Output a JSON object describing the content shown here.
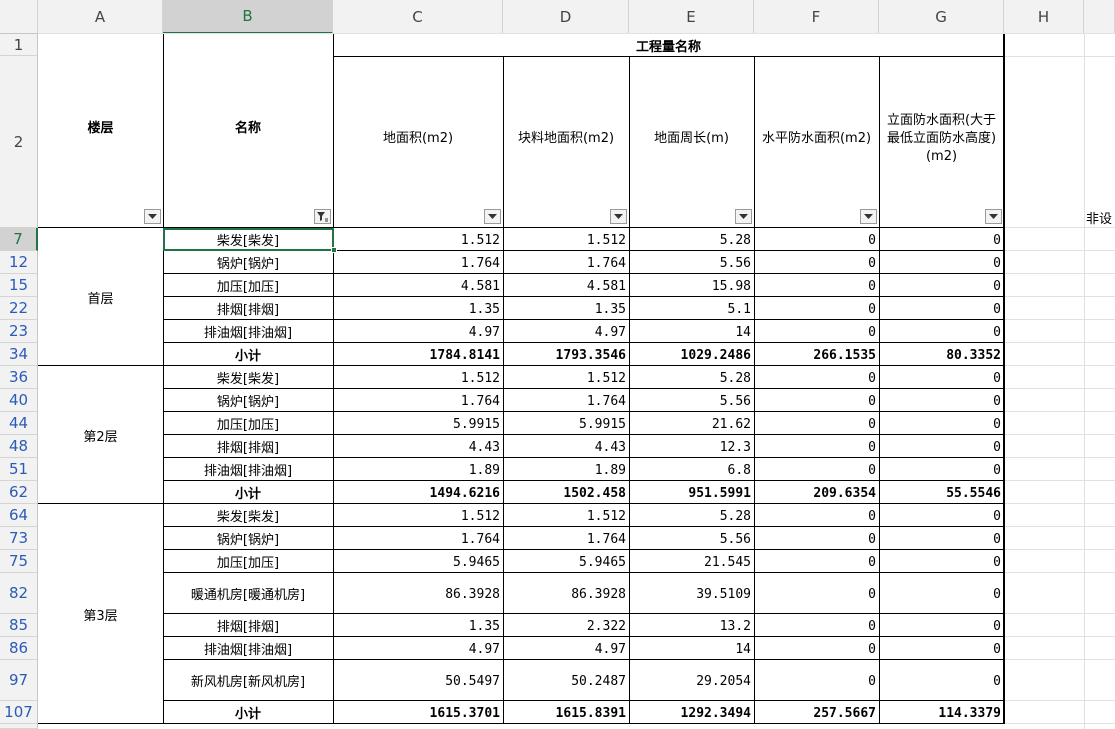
{
  "column_headers": [
    "A",
    "B",
    "C",
    "D",
    "E",
    "F",
    "G",
    "H"
  ],
  "selected_column": "B",
  "header": {
    "row_numbers": [
      "1",
      "2"
    ],
    "merged_title": "工程量名称",
    "floor_label": "楼层",
    "name_label": "名称",
    "columns": [
      "地面积(m2)",
      "块料地面积(m2)",
      "地面周长(m)",
      "水平防水面积(m2)",
      "立面防水面积(大于最低立面防水高度)(m2)"
    ],
    "right_overflow_text": "非设"
  },
  "groups": [
    {
      "floor": "首层",
      "rows": [
        {
          "row": "7",
          "name": "柴发[柴发]",
          "c": "1.512",
          "d": "1.512",
          "e": "5.28",
          "f": "0",
          "g": "0"
        },
        {
          "row": "12",
          "name": "锅炉[锅炉]",
          "c": "1.764",
          "d": "1.764",
          "e": "5.56",
          "f": "0",
          "g": "0"
        },
        {
          "row": "15",
          "name": "加压[加压]",
          "c": "4.581",
          "d": "4.581",
          "e": "15.98",
          "f": "0",
          "g": "0"
        },
        {
          "row": "22",
          "name": "排烟[排烟]",
          "c": "1.35",
          "d": "1.35",
          "e": "5.1",
          "f": "0",
          "g": "0"
        },
        {
          "row": "23",
          "name": "排油烟[排油烟]",
          "c": "4.97",
          "d": "4.97",
          "e": "14",
          "f": "0",
          "g": "0"
        },
        {
          "row": "34",
          "name": "小计",
          "c": "1784.8141",
          "d": "1793.3546",
          "e": "1029.2486",
          "f": "266.1535",
          "g": "80.3352",
          "subtotal": true
        }
      ]
    },
    {
      "floor": "第2层",
      "rows": [
        {
          "row": "36",
          "name": "柴发[柴发]",
          "c": "1.512",
          "d": "1.512",
          "e": "5.28",
          "f": "0",
          "g": "0"
        },
        {
          "row": "40",
          "name": "锅炉[锅炉]",
          "c": "1.764",
          "d": "1.764",
          "e": "5.56",
          "f": "0",
          "g": "0"
        },
        {
          "row": "44",
          "name": "加压[加压]",
          "c": "5.9915",
          "d": "5.9915",
          "e": "21.62",
          "f": "0",
          "g": "0"
        },
        {
          "row": "48",
          "name": "排烟[排烟]",
          "c": "4.43",
          "d": "4.43",
          "e": "12.3",
          "f": "0",
          "g": "0"
        },
        {
          "row": "51",
          "name": "排油烟[排油烟]",
          "c": "1.89",
          "d": "1.89",
          "e": "6.8",
          "f": "0",
          "g": "0"
        },
        {
          "row": "62",
          "name": "小计",
          "c": "1494.6216",
          "d": "1502.458",
          "e": "951.5991",
          "f": "209.6354",
          "g": "55.5546",
          "subtotal": true
        }
      ]
    },
    {
      "floor": "第3层",
      "rows": [
        {
          "row": "64",
          "name": "柴发[柴发]",
          "c": "1.512",
          "d": "1.512",
          "e": "5.28",
          "f": "0",
          "g": "0"
        },
        {
          "row": "73",
          "name": "锅炉[锅炉]",
          "c": "1.764",
          "d": "1.764",
          "e": "5.56",
          "f": "0",
          "g": "0"
        },
        {
          "row": "75",
          "name": "加压[加压]",
          "c": "5.9465",
          "d": "5.9465",
          "e": "21.545",
          "f": "0",
          "g": "0"
        },
        {
          "row": "82",
          "name": "暖通机房[暖通机房]",
          "c": "86.3928",
          "d": "86.3928",
          "e": "39.5109",
          "f": "0",
          "g": "0",
          "tall": true
        },
        {
          "row": "85",
          "name": "排烟[排烟]",
          "c": "1.35",
          "d": "2.322",
          "e": "13.2",
          "f": "0",
          "g": "0"
        },
        {
          "row": "86",
          "name": "排油烟[排油烟]",
          "c": "4.97",
          "d": "4.97",
          "e": "14",
          "f": "0",
          "g": "0"
        },
        {
          "row": "97",
          "name": "新风机房[新风机房]",
          "c": "50.5497",
          "d": "50.2487",
          "e": "29.2054",
          "f": "0",
          "g": "0",
          "tall": true
        },
        {
          "row": "107",
          "name": "小计",
          "c": "1615.3701",
          "d": "1615.8391",
          "e": "1292.3494",
          "f": "257.5667",
          "g": "114.3379",
          "subtotal": true
        }
      ]
    }
  ],
  "selected_cell": "B7",
  "icons": {
    "dropdown": "filter-dropdown-icon",
    "filter_active": "filter-active-icon"
  },
  "colors": {
    "selection": "#217346",
    "row_number": "#2a5bb8",
    "header_bg": "#f2f2f2"
  }
}
